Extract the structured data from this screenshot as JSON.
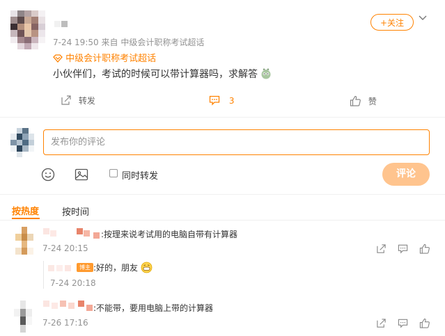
{
  "post": {
    "time": "7-24 19:50",
    "source_prefix": "来自",
    "source": "中级会计职称考试超话",
    "topic_tag": "中级会计职称考试超话",
    "text": "小伙伴们，考试的时候可以带计算器吗，求解答",
    "follow_label": "+关注",
    "actions": {
      "repost_label": "转发",
      "comment_count": "3",
      "like_label": "赞"
    }
  },
  "compose": {
    "placeholder": "发布你的评论",
    "also_repost_label": "同时转发",
    "submit_label": "评论"
  },
  "sort_tabs": {
    "hot": "按热度",
    "time": "按时间"
  },
  "comments": [
    {
      "text": ":按理来说考试用的电脑自带有计算器",
      "time": "7-24 20:15",
      "reply": {
        "badge": "博主",
        "text": ":好的，朋友",
        "time": "7-24 20:18"
      }
    },
    {
      "text": ":不能带，要用电脑上带的计算器",
      "time": "7-26 17:16"
    }
  ],
  "colors": {
    "accent": "#ff8200",
    "submit_disabled": "#ffc48e",
    "muted_text": "#939393"
  },
  "icons": [
    "chevron-down-icon",
    "super-topic-icon",
    "repost-icon",
    "comment-icon",
    "like-icon",
    "emoji-icon",
    "image-icon",
    "reply-badge"
  ]
}
